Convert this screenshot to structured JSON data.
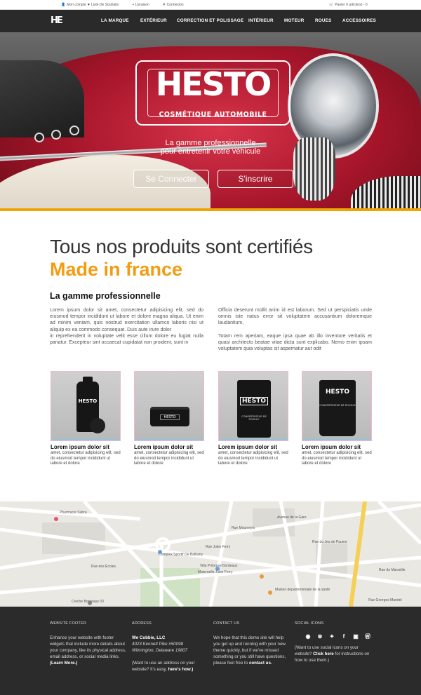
{
  "topbar": {
    "account": "Mon compte",
    "wishlist": "Liste De Souhaits",
    "delivery": "Livraison",
    "login": "Connexion",
    "cart": "Panier 0 article(s) - 0"
  },
  "nav": {
    "logo": "HE",
    "items": [
      "LA MARQUE",
      "EXTÉRIEUR",
      "CORRECTION ET POLISSAGE",
      "INTÉRIEUR",
      "MOTEUR",
      "ROUES",
      "ACCESSOIRES"
    ]
  },
  "hero": {
    "brand": "HESTO",
    "brand_sub": "COSMÉTIQUE AUTOMOBILE",
    "tagline_1": "La gamme professionnelle",
    "tagline_2": "pour entretenir votre véhicule",
    "login_button": "Se Connecter",
    "signup_button": "S'inscrire",
    "accent_color": "#f0a400"
  },
  "intro": {
    "title": "Tous nos produits sont certifiés",
    "highlight": "Made in france",
    "highlight_color": "#f39c12",
    "subtitle": "La gamme professionnelle",
    "col1_p1": "Lorem ipsum dolor sit amet, consectetur adipisicing elit, sed do eiusmod tempor incididunt ut labore et dolore magna aliqua. Ut enim ad minim veniam, quis nostrud exercitation ullamco laboris nisi ut aliquip ex ea commodo consequat. Duis aute irure dolor",
    "col1_p2": "in reprehenderit in voluptate velit esse cillum dolore eu fugiat nulla pariatur. Excepteur sint occaecat cupidatat non proident, sunt in",
    "col2_p1": "Officia deserunt mollit anim id est laborum. Sed ut perspiciatis unde omnis iste natus error sit voluptatem accusantium doloremque laudantium,",
    "col2_p2": "Totam rem aperiam, eaque ipsa quae ab illo inventore veritatis et quasi architecto beatae vitae dicta sunt explicabo. Nemo enim ipsam voluptatem quia voluptas sit aspernatur aut odit"
  },
  "products": [
    {
      "title": "Lorem ipsum dolor sit",
      "desc": "amet, consectetur adipisicing elit, sed do eiusmod tempor incididunt ut labore et dolore",
      "label": "HESTO"
    },
    {
      "title": "Lorem ipsum dolor sit",
      "desc": "amet, consectetur adipisicing elit, sed do eiusmod tempor incididunt ut labore et dolore",
      "label": "HESTO"
    },
    {
      "title": "Lorem ipsum dolor sit",
      "desc": "amet, consectetur adipisicing elit, sed do eiusmod tempor incididunt ut labore et dolore",
      "label": "HESTO",
      "sub": "CONVERTISSEUR DE ROUILLE"
    },
    {
      "title": "Lorem ipsum dolor sit",
      "desc": "amet, consectetur adipisicing elit, sed do eiusmod tempor incididunt ut labore et dolore",
      "label": "HESTO",
      "sub": "CONVERTISSEUR DE ROUILLE"
    }
  ],
  "map": {
    "labels": [
      "Pharmacie Subra",
      "Complex Sportif De Bathany",
      "Villa Primrose Bordeaux",
      "Maternelle Jules Ferry",
      "Maison départementale de la santé",
      "Creche Bordeaux 03",
      "Rue Jules Ferry",
      "Rue des Écoles",
      "Avenue de la Gare",
      "Rue du Jeu de Paume",
      "Rue Georges Mandel",
      "Rue Mouneyra",
      "Rue de Marseille"
    ]
  },
  "footer": {
    "col1": {
      "heading": "WEBSITE FOOTER",
      "text": "Enhance your website with footer widgets that include more details about your company, like its physical address, email address, or social media links.",
      "link": "(Learn More.)"
    },
    "col2": {
      "heading": "ADDRESS",
      "company": "We Cobbie, LLC",
      "street": "4023 Kennett Pike #50098",
      "city": "Wilmington, Delaware 19807",
      "note": "(Want to use an address on your website? It's easy,",
      "link": "here's how.)"
    },
    "col3": {
      "heading": "CONTACT US",
      "text": "We hope that this demo site will help you get up and running with your new theme quickly, but if we've missed something or you still have questions, please feel free to",
      "link": "contact us."
    },
    "col4": {
      "heading": "SOCIAL ICONS",
      "icons": [
        "github-icon",
        "dribbble-icon",
        "twitter-icon",
        "facebook-icon",
        "flickr-icon",
        "wordpress-icon"
      ],
      "text_1": "(Want to use social icons on your website?",
      "link": "Click here",
      "text_2": "for instructions on how to use them.)"
    }
  }
}
